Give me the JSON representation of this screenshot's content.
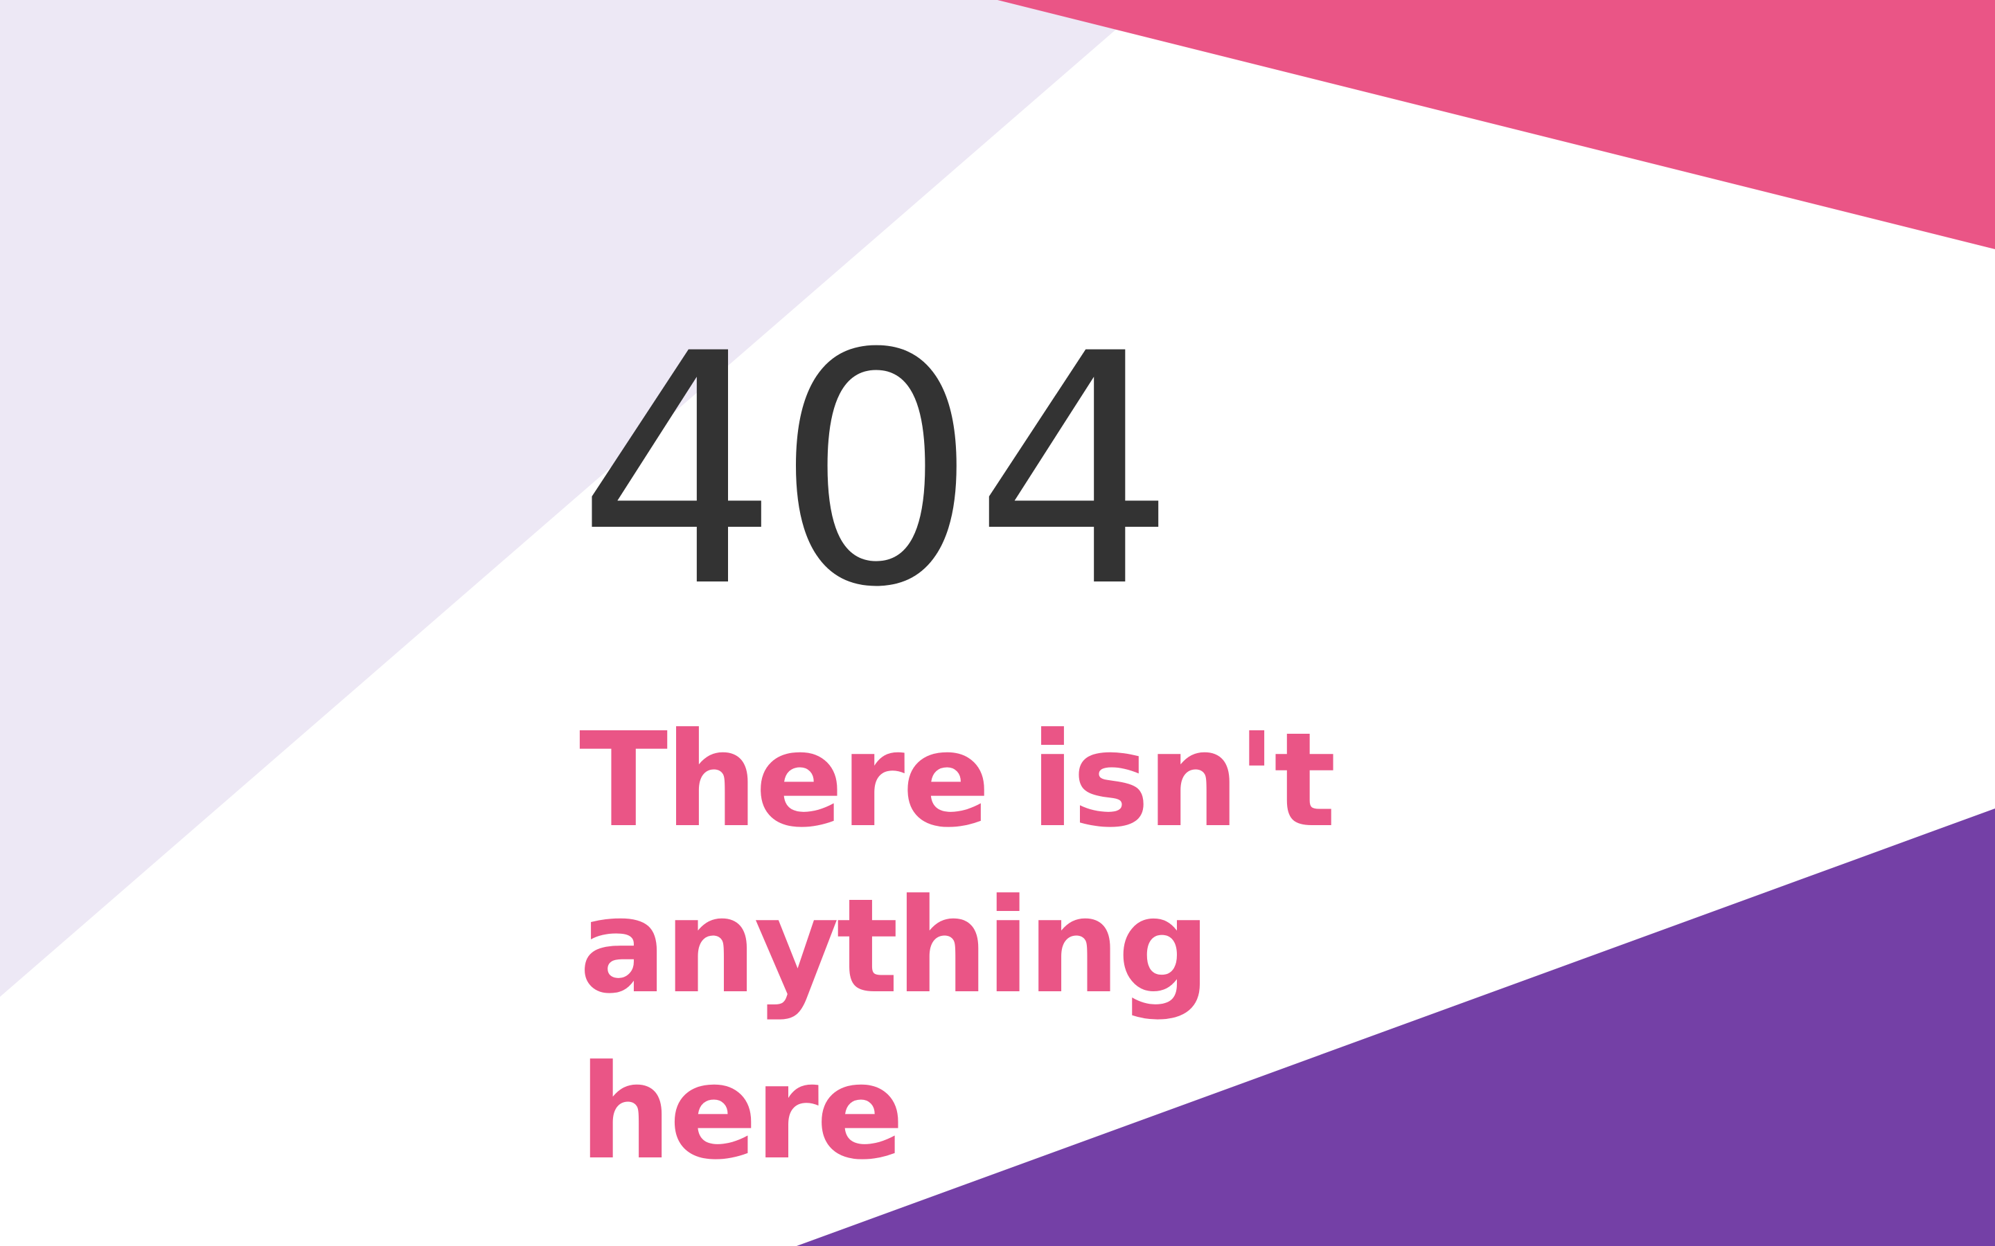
{
  "page": {
    "error_code": "404",
    "message": "There isn't anything here"
  },
  "colors": {
    "background": "#ffffff",
    "lavender_shape": "#ede8f5",
    "pink_shape": "#ea5586",
    "purple_shape": "#7440a6",
    "error_code_text": "#333333",
    "message_text": "#ea5586"
  }
}
